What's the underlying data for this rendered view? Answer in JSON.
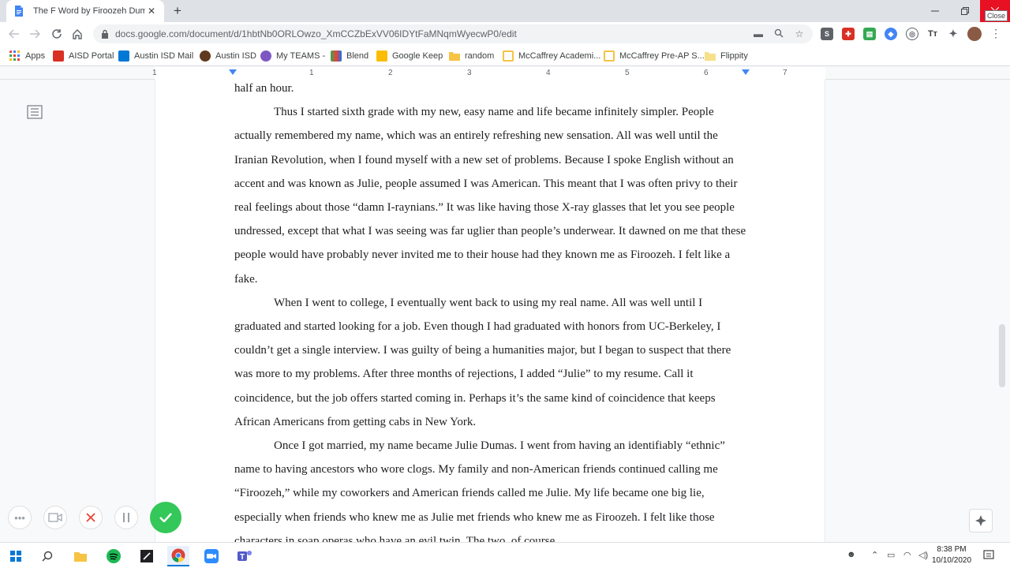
{
  "browser": {
    "tab_title": "The F Word by Firoozeh Dumas",
    "tab_close_glyph": "✕",
    "new_tab_glyph": "+",
    "url": "docs.google.com/document/d/1hbtNb0ORLOwzo_XmCCZbExVV06IDYtFaMNqmWyecwP0/edit",
    "close_tooltip": "Close"
  },
  "bookmarks": [
    {
      "label": "Apps",
      "color": "#ea4335"
    },
    {
      "label": "AISD Portal",
      "color": "#d93025"
    },
    {
      "label": "Austin ISD Mail",
      "color": "#0078d4"
    },
    {
      "label": "Austin ISD",
      "color": "#5f3a1e"
    },
    {
      "label": "My TEAMS -",
      "color": "#7e57c2"
    },
    {
      "label": "Blend",
      "color": "#1a73e8"
    },
    {
      "label": "Google Keep",
      "color": "#fbbc04"
    },
    {
      "label": "random",
      "color": "#f6c344"
    },
    {
      "label": "McCaffrey Academi...",
      "color": "#f6c344"
    },
    {
      "label": "McCaffrey Pre-AP S...",
      "color": "#f6c344"
    },
    {
      "label": "Flippity",
      "color": "#f6c344"
    }
  ],
  "ruler": {
    "ticks": [
      "1",
      "1",
      "2",
      "3",
      "4",
      "5",
      "6",
      "7"
    ]
  },
  "document": {
    "paragraphs": [
      "half an hour.",
      "Thus I started sixth grade with my new, easy name and life became infinitely simpler. People actually remembered my name, which was an entirely refreshing new sensation. All was well until the Iranian Revolution, when I found myself with a new set of problems. Because I spoke English without an accent and was known as Julie, people assumed I was American. This meant that I was often privy to their real feelings about those “damn I-raynians.” It was like having those X-ray glasses that let you see people undressed, except that what I was seeing was far uglier than people’s underwear. It dawned on me that these people would have probably never invited me to their house had they known me as Firoozeh. I felt like a fake.",
      "When I went to college, I eventually went back to using my real name. All was well until I graduated and started looking for a job. Even though I had graduated with honors from UC-Berkeley, I couldn’t get a single interview. I was guilty of being a humanities major, but I began to suspect that there was more to my problems. After three months of rejections, I added “Julie” to my resume. Call it coincidence, but the job offers started coming in. Perhaps it’s the same kind of coincidence that keeps African Americans from getting cabs in New York.",
      "Once I got married, my name became Julie Dumas. I went from having an identifiably “ethnic” name to having ancestors who wore clogs. My family and non-American friends continued calling me “Firoozeh,” while my coworkers and American friends called me Julie. My life became one big lie, especially when friends who knew me as Julie met friends who knew me as Firoozeh. I felt like those characters in soap operas who have an evil twin. The two, of course,"
    ]
  },
  "taskbar": {
    "time": "8:38 PM",
    "date": "10/10/2020"
  },
  "colors": {
    "accent": "#1a73e8",
    "close_red": "#e81123",
    "record_green": "#34c759"
  }
}
